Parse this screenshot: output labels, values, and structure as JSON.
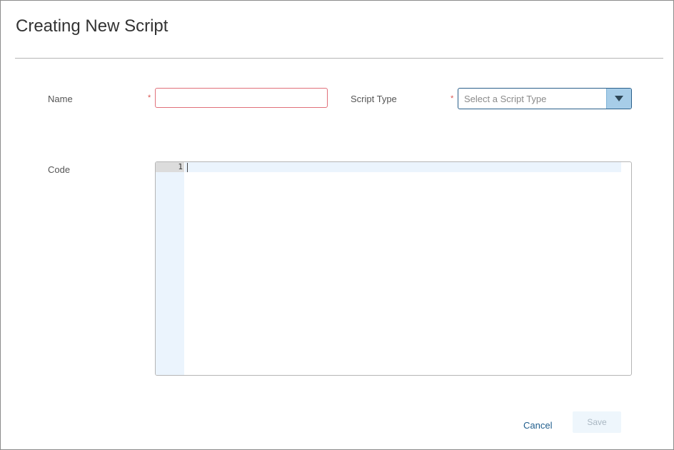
{
  "dialog": {
    "title": "Creating New Script"
  },
  "form": {
    "name": {
      "label": "Name",
      "required_marker": "*",
      "value": "",
      "placeholder": ""
    },
    "script_type": {
      "label": "Script Type",
      "required_marker": "*",
      "placeholder": "Select a Script Type",
      "selected": ""
    },
    "code": {
      "label": "Code",
      "line_numbers": [
        "1"
      ],
      "content": ""
    }
  },
  "footer": {
    "cancel_label": "Cancel",
    "save_label": "Save"
  },
  "colors": {
    "accent": "#1f5d8c",
    "required": "#d9534f",
    "invalid_border": "#e0707a",
    "dropdown_button": "#a7cde8",
    "editor_gutter": "#ebf4fd"
  },
  "icons": {
    "dropdown": "caret-down-icon"
  }
}
